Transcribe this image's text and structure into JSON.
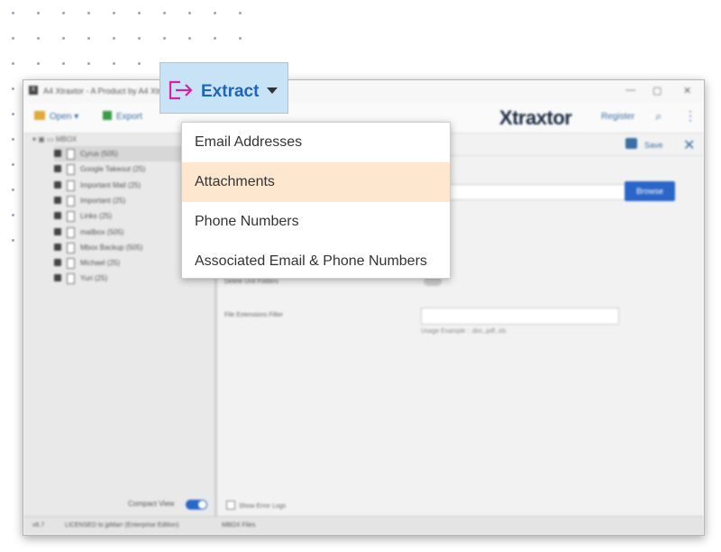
{
  "window": {
    "title": "A4 Xtraxtor - A Product by A4 Xtraxtor",
    "app_icon": "X",
    "minimize": "—",
    "maximize": "▢",
    "close": "✕"
  },
  "toolbar": {
    "open_label": "Open",
    "export_label": "Export",
    "brand_x": "X",
    "brand_rest": "traxtor",
    "register_label": "Register"
  },
  "sidebar": {
    "root_label": "MBOX",
    "items": [
      {
        "label": "Cyrus (505)"
      },
      {
        "label": "Google Takeout (25)"
      },
      {
        "label": "Important Mail (25)"
      },
      {
        "label": "Important (25)"
      },
      {
        "label": "Links (25)"
      },
      {
        "label": "mailbox (505)"
      },
      {
        "label": "Mbox Backup (505)"
      },
      {
        "label": "Michael (25)"
      },
      {
        "label": "Yuri (25)"
      }
    ],
    "compact_view_label": "Compact View"
  },
  "main": {
    "save_label": "Save",
    "close_label": "✕",
    "browse_label": "Browse",
    "option1_label": "Delete Unit Folders",
    "option2_label": "File Extensions Filter",
    "filter_hint": "Usage Example : .doc,.pdf,.xls",
    "error_logs_label": "Show Error Logs"
  },
  "statusbar": {
    "version": "v6.7",
    "license": "LICENSED to jpMarr (Enterprise Edition)",
    "count": "MBOX Files"
  },
  "extract": {
    "label": "Extract",
    "icon": "export-arrow-icon",
    "icon_color": "#d6229f",
    "label_color": "#1d66b8"
  },
  "menu": {
    "items": [
      {
        "label": "Email Addresses",
        "highlighted": false
      },
      {
        "label": "Attachments",
        "highlighted": true
      },
      {
        "label": "Phone Numbers",
        "highlighted": false
      },
      {
        "label": "Associated Email & Phone Numbers",
        "highlighted": false
      }
    ]
  },
  "colors": {
    "accent": "#2a66c9",
    "extract_bg": "#c7e3f5",
    "highlight": "#fde8cf"
  }
}
